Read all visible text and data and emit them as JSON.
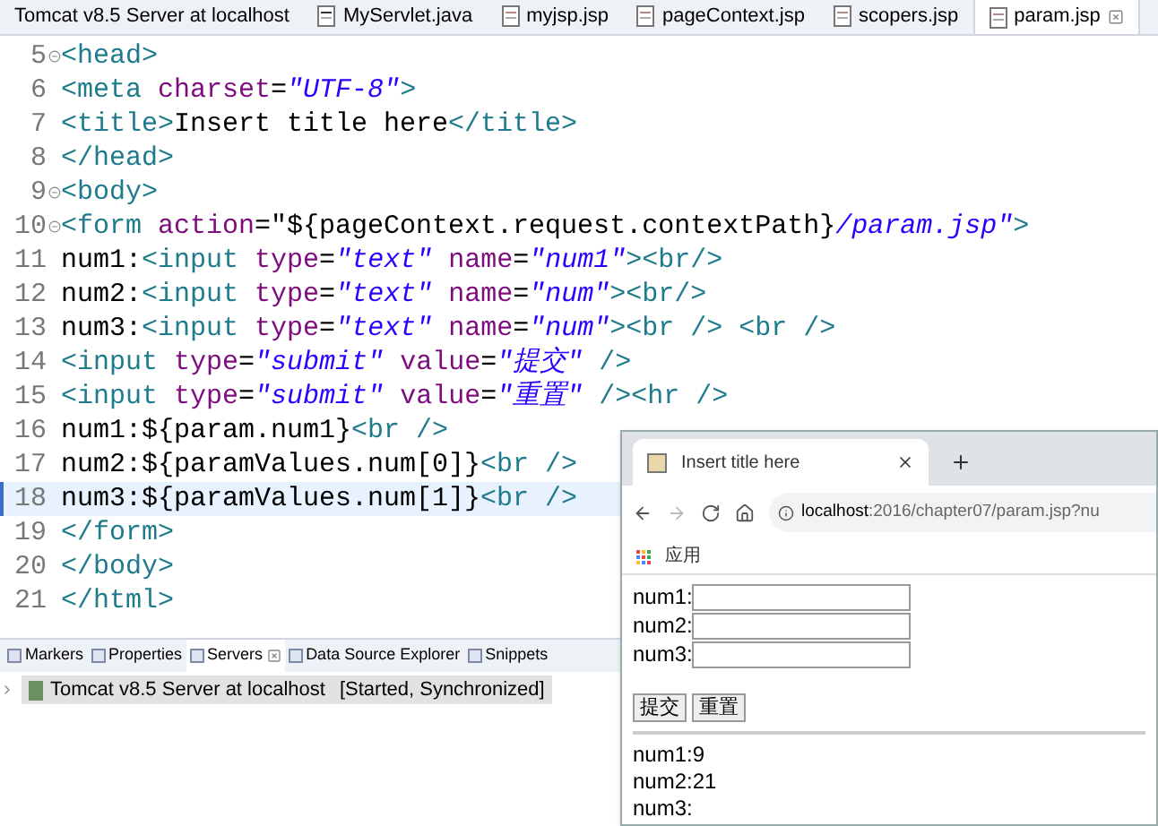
{
  "editor_tabs": [
    {
      "label": "Tomcat v8.5 Server at localhost",
      "kind": "server",
      "selected": false
    },
    {
      "label": "MyServlet.java",
      "kind": "java",
      "selected": false
    },
    {
      "label": "myjsp.jsp",
      "kind": "jsp",
      "selected": false
    },
    {
      "label": "pageContext.jsp",
      "kind": "jsp",
      "selected": false
    },
    {
      "label": "scopers.jsp",
      "kind": "jsp",
      "selected": false
    },
    {
      "label": "param.jsp",
      "kind": "jsp",
      "selected": true
    }
  ],
  "code_lines": [
    {
      "number": "5",
      "foldable": true,
      "current": false,
      "tokens": [
        {
          "kind": "tag",
          "text": "<head>"
        }
      ]
    },
    {
      "number": "6",
      "foldable": false,
      "current": false,
      "tokens": [
        {
          "kind": "tag",
          "text": "<meta "
        },
        {
          "kind": "attr",
          "text": "charset"
        },
        {
          "kind": "text",
          "text": "="
        },
        {
          "kind": "str",
          "text": "\"UTF-8\""
        },
        {
          "kind": "tag",
          "text": ">"
        }
      ]
    },
    {
      "number": "7",
      "foldable": false,
      "current": false,
      "tokens": [
        {
          "kind": "tag",
          "text": "<title>"
        },
        {
          "kind": "text",
          "text": "Insert title here"
        },
        {
          "kind": "tag",
          "text": "</title>"
        }
      ]
    },
    {
      "number": "8",
      "foldable": false,
      "current": false,
      "tokens": [
        {
          "kind": "tag",
          "text": "</head>"
        }
      ]
    },
    {
      "number": "9",
      "foldable": true,
      "current": false,
      "tokens": [
        {
          "kind": "tag",
          "text": "<body>"
        }
      ]
    },
    {
      "number": "10",
      "foldable": true,
      "current": false,
      "tokens": [
        {
          "kind": "tag",
          "text": "<form "
        },
        {
          "kind": "attr",
          "text": "action"
        },
        {
          "kind": "text",
          "text": "=\"${pageContext.request.contextPath}"
        },
        {
          "kind": "str",
          "text": "/param.jsp\""
        },
        {
          "kind": "tag",
          "text": ">"
        }
      ]
    },
    {
      "number": "11",
      "foldable": false,
      "current": false,
      "tokens": [
        {
          "kind": "text",
          "text": "num1:"
        },
        {
          "kind": "tag",
          "text": "<input "
        },
        {
          "kind": "attr",
          "text": "type"
        },
        {
          "kind": "text",
          "text": "="
        },
        {
          "kind": "str",
          "text": "\"text\""
        },
        {
          "kind": "attr",
          "text": " name"
        },
        {
          "kind": "text",
          "text": "="
        },
        {
          "kind": "str",
          "text": "\"num1\""
        },
        {
          "kind": "tag",
          "text": "><br/>"
        }
      ]
    },
    {
      "number": "12",
      "foldable": false,
      "current": false,
      "tokens": [
        {
          "kind": "text",
          "text": "num2:"
        },
        {
          "kind": "tag",
          "text": "<input "
        },
        {
          "kind": "attr",
          "text": "type"
        },
        {
          "kind": "text",
          "text": "="
        },
        {
          "kind": "str",
          "text": "\"text\""
        },
        {
          "kind": "attr",
          "text": " name"
        },
        {
          "kind": "text",
          "text": "="
        },
        {
          "kind": "str",
          "text": "\"num\""
        },
        {
          "kind": "tag",
          "text": "><br/>"
        }
      ]
    },
    {
      "number": "13",
      "foldable": false,
      "current": false,
      "tokens": [
        {
          "kind": "text",
          "text": "num3:"
        },
        {
          "kind": "tag",
          "text": "<input "
        },
        {
          "kind": "attr",
          "text": "type"
        },
        {
          "kind": "text",
          "text": "="
        },
        {
          "kind": "str",
          "text": "\"text\""
        },
        {
          "kind": "attr",
          "text": " name"
        },
        {
          "kind": "text",
          "text": "="
        },
        {
          "kind": "str",
          "text": "\"num\""
        },
        {
          "kind": "tag",
          "text": "><br /> <br />"
        }
      ]
    },
    {
      "number": "14",
      "foldable": false,
      "current": false,
      "tokens": [
        {
          "kind": "tag",
          "text": "<input "
        },
        {
          "kind": "attr",
          "text": "type"
        },
        {
          "kind": "text",
          "text": "="
        },
        {
          "kind": "str",
          "text": "\"submit\""
        },
        {
          "kind": "attr",
          "text": " value"
        },
        {
          "kind": "text",
          "text": "="
        },
        {
          "kind": "str",
          "text": "\"提交\""
        },
        {
          "kind": "tag",
          "text": " />"
        }
      ]
    },
    {
      "number": "15",
      "foldable": false,
      "current": false,
      "tokens": [
        {
          "kind": "tag",
          "text": "<input "
        },
        {
          "kind": "attr",
          "text": "type"
        },
        {
          "kind": "text",
          "text": "="
        },
        {
          "kind": "str",
          "text": "\"submit\""
        },
        {
          "kind": "attr",
          "text": " value"
        },
        {
          "kind": "text",
          "text": "="
        },
        {
          "kind": "str",
          "text": "\"重置\""
        },
        {
          "kind": "tag",
          "text": " /><hr />"
        }
      ]
    },
    {
      "number": "16",
      "foldable": false,
      "current": false,
      "tokens": [
        {
          "kind": "text",
          "text": "num1:${param.num1}"
        },
        {
          "kind": "tag",
          "text": "<br />"
        }
      ]
    },
    {
      "number": "17",
      "foldable": false,
      "current": false,
      "tokens": [
        {
          "kind": "text",
          "text": "num2:${paramValues.num[0]}"
        },
        {
          "kind": "tag",
          "text": "<br />"
        }
      ]
    },
    {
      "number": "18",
      "foldable": false,
      "current": true,
      "tokens": [
        {
          "kind": "text",
          "text": "num3:${paramValues.num[1]}"
        },
        {
          "kind": "tag",
          "text": "<br />"
        }
      ]
    },
    {
      "number": "19",
      "foldable": false,
      "current": false,
      "tokens": [
        {
          "kind": "tag",
          "text": "</form>"
        }
      ]
    },
    {
      "number": "20",
      "foldable": false,
      "current": false,
      "tokens": [
        {
          "kind": "tag",
          "text": "</body>"
        }
      ]
    },
    {
      "number": "21",
      "foldable": false,
      "current": false,
      "tokens": [
        {
          "kind": "tag",
          "text": "</html>"
        }
      ]
    }
  ],
  "panel_tabs": [
    {
      "label": "Markers",
      "selected": false
    },
    {
      "label": "Properties",
      "selected": false
    },
    {
      "label": "Servers",
      "selected": true
    },
    {
      "label": "Data Source Explorer",
      "selected": false
    },
    {
      "label": "Snippets",
      "selected": false
    }
  ],
  "server_row": {
    "name": "Tomcat v8.5 Server at localhost",
    "status": "[Started, Synchronized]"
  },
  "browser": {
    "tab_title": "Insert title here",
    "url_host": "localhost",
    "url_rest": ":2016/chapter07/param.jsp?nu",
    "bookmark": "应用",
    "fields": [
      {
        "label": "num1:"
      },
      {
        "label": "num2:"
      },
      {
        "label": "num3:"
      }
    ],
    "buttons": [
      "提交",
      "重置"
    ],
    "results": [
      "num1:9",
      "num2:21",
      "num3:"
    ]
  }
}
